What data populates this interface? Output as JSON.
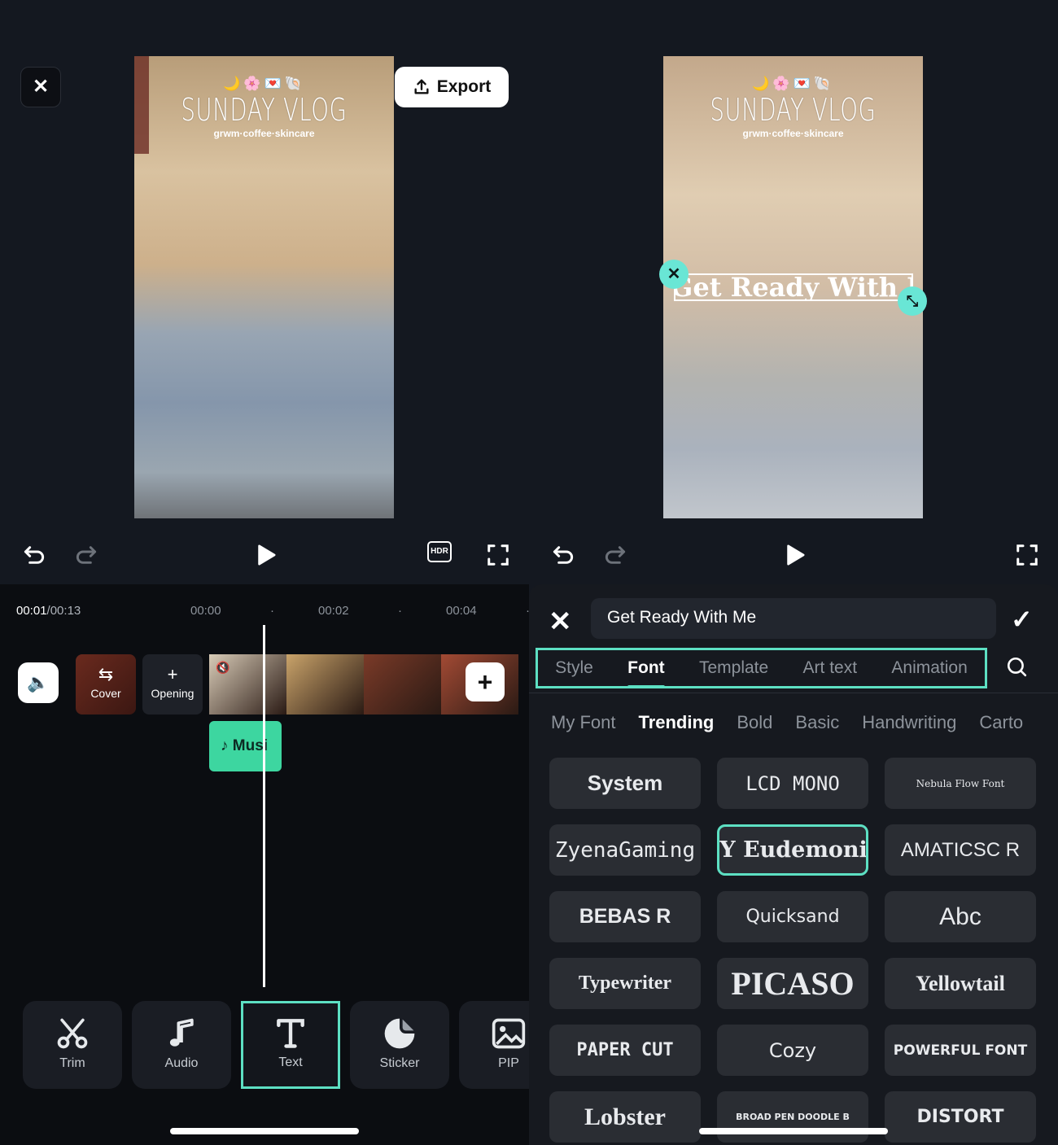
{
  "left": {
    "video": {
      "emoji": "🌙🌸💌🐚",
      "title": "SUNDAY VLOG",
      "subtitle": "grwm·coffee·skincare"
    },
    "export_label": "Export",
    "close_icon": "close-icon",
    "timeline": {
      "current_time": "00:01",
      "total_time": "/00:13",
      "ticks": [
        "00:00",
        "00:02",
        "00:04"
      ],
      "cover_label": "Cover",
      "opening_label": "Opening",
      "music_label": "Musi",
      "clip_colors": [
        "#d8cbb7",
        "#c9a36a",
        "#7a3a28",
        "#a24a34"
      ]
    },
    "toolbar": [
      {
        "label": "Trim",
        "icon": "scissors-icon"
      },
      {
        "label": "Audio",
        "icon": "music-note-icon"
      },
      {
        "label": "Text",
        "icon": "text-icon"
      },
      {
        "label": "Sticker",
        "icon": "sticker-icon"
      },
      {
        "label": "PIP",
        "icon": "pip-icon"
      }
    ]
  },
  "right": {
    "video": {
      "emoji": "🌙🌸💌🐚",
      "title": "SUNDAY VLOG",
      "subtitle": "grwm·coffee·skincare",
      "overlay_text": "Get Ready With Me"
    },
    "editor": {
      "input_value": "Get Ready With Me",
      "main_tabs": [
        "Style",
        "Font",
        "Template",
        "Art text",
        "Animation"
      ],
      "active_main_tab": "Font",
      "category_tabs": [
        "My Font",
        "Trending",
        "Bold",
        "Basic",
        "Handwriting",
        "Carto"
      ],
      "active_category": "Trending",
      "fonts": [
        {
          "label": "System",
          "family": "Liberation Sans",
          "weight": "bold",
          "size": 26
        },
        {
          "label": "LCD MONO",
          "family": "DejaVu Sans Mono",
          "weight": "normal",
          "size": 24
        },
        {
          "label": "Nebula Flow Font",
          "family": "DejaVu Serif",
          "weight": "normal",
          "size": 12
        },
        {
          "label": "ZyenaGaming",
          "family": "DejaVu Sans Mono",
          "weight": "normal",
          "size": 26
        },
        {
          "label": "ZY Eudemonia",
          "family": "DejaVu Serif",
          "weight": "bold",
          "size": 27
        },
        {
          "label": "AMATICSC R",
          "family": "Liberation Sans Narrow",
          "weight": "normal",
          "size": 24
        },
        {
          "label": "BEBAS R",
          "family": "Liberation Sans",
          "weight": "bold",
          "size": 25
        },
        {
          "label": "Quicksand",
          "family": "DejaVu Sans",
          "weight": "normal",
          "size": 22
        },
        {
          "label": "Abc",
          "family": "Liberation Sans",
          "weight": "normal",
          "size": 30
        },
        {
          "label": "Typewriter",
          "family": "Liberation Serif",
          "weight": "bold",
          "size": 24
        },
        {
          "label": "PICASO",
          "family": "Liberation Serif",
          "weight": "bold",
          "size": 40
        },
        {
          "label": "Yellowtail",
          "family": "Liberation Serif",
          "weight": "bold",
          "size": 26
        },
        {
          "label": "PAPER CUT",
          "family": "DejaVu Sans Mono",
          "weight": "bold",
          "size": 22
        },
        {
          "label": "Cozy",
          "family": "DejaVu Sans",
          "weight": "normal",
          "size": 24
        },
        {
          "label": "POWERFUL FONT",
          "family": "DejaVu Sans",
          "weight": "bold",
          "size": 17
        },
        {
          "label": "Lobster",
          "family": "Liberation Serif",
          "weight": "bold",
          "size": 30
        },
        {
          "label": "BROAD PEN DOODLE B",
          "family": "DejaVu Sans",
          "weight": "bold",
          "size": 11
        },
        {
          "label": "DISTORT",
          "family": "DejaVu Sans",
          "weight": "bold",
          "size": 22
        }
      ],
      "selected_font": "ZY Eudemonia"
    }
  },
  "colors": {
    "accent": "#5de0c3",
    "overlay_handle": "#69e6d5",
    "music_clip": "#3dd6a0",
    "background": "#141820"
  }
}
